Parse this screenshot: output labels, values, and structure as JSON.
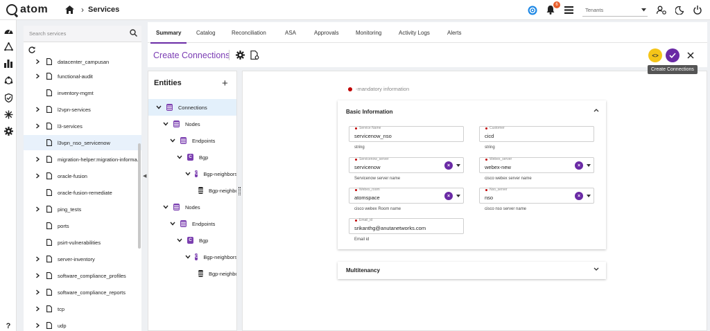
{
  "app": {
    "logo_text": "atom",
    "breadcrumb": "Services",
    "notification_count": "6",
    "tenant_placeholder": "Tenants"
  },
  "rail": {
    "help_label": "?"
  },
  "services": {
    "search_placeholder": "Search services",
    "items": [
      {
        "name": "datacenter_campusan",
        "expandable": true
      },
      {
        "name": "functional-audit",
        "expandable": true
      },
      {
        "name": "inventory-mgmt",
        "expandable": false
      },
      {
        "name": "l2vpn-services",
        "expandable": true
      },
      {
        "name": "l3-services",
        "expandable": true
      },
      {
        "name": "l3vpn_nso_servicenow",
        "expandable": false,
        "selected": true
      },
      {
        "name": "migration-helper:migration-informa...",
        "expandable": true
      },
      {
        "name": "oracle-fusion",
        "expandable": true
      },
      {
        "name": "oracle-fusion-remediate",
        "expandable": false
      },
      {
        "name": "ping_tests",
        "expandable": true
      },
      {
        "name": "ports",
        "expandable": false
      },
      {
        "name": "psirt-vulnerabilities",
        "expandable": false
      },
      {
        "name": "server-inventory",
        "expandable": true
      },
      {
        "name": "software_compliance_profiles",
        "expandable": true
      },
      {
        "name": "software_compliance_reports",
        "expandable": true
      },
      {
        "name": "tcp",
        "expandable": true
      },
      {
        "name": "udp",
        "expandable": true
      }
    ]
  },
  "tabs": [
    "Summary",
    "Catalog",
    "Reconciliation",
    "ASA",
    "Approvals",
    "Monitoring",
    "Activity Logs",
    "Alerts"
  ],
  "form": {
    "title": "Create Connections",
    "code_button_label": "<>",
    "tooltip": "Create Connections",
    "mandatory_text": "-mandatory information"
  },
  "entities": {
    "title": "Entities",
    "add_label": "+",
    "nodes": [
      {
        "label": "Connections",
        "level": 0,
        "icon": "list",
        "icon_text": "",
        "chevron": "down",
        "selected": true
      },
      {
        "label": "Nodes",
        "level": 1,
        "icon": "list",
        "icon_text": "",
        "chevron": "down"
      },
      {
        "label": "Endpoints",
        "level": 2,
        "icon": "list",
        "icon_text": "",
        "chevron": "down"
      },
      {
        "label": "Bgp",
        "level": 3,
        "icon": "cont",
        "icon_text": "C",
        "chevron": "down"
      },
      {
        "label": "Bgp-neighbors",
        "level": 4,
        "icon": "cont",
        "icon_text": "C",
        "chevron": "down"
      },
      {
        "label": "Bgp-neighbor",
        "level": 5,
        "icon": "leaf",
        "icon_text": "",
        "chevron": "none"
      },
      {
        "label": "Nodes",
        "level": 1,
        "icon": "list",
        "icon_text": "",
        "chevron": "down"
      },
      {
        "label": "Endpoints",
        "level": 2,
        "icon": "list",
        "icon_text": "",
        "chevron": "down"
      },
      {
        "label": "Bgp",
        "level": 3,
        "icon": "cont",
        "icon_text": "C",
        "chevron": "down"
      },
      {
        "label": "Bgp-neighbors",
        "level": 4,
        "icon": "cont",
        "icon_text": "C",
        "chevron": "down"
      },
      {
        "label": "Bgp-neighbor",
        "level": 5,
        "icon": "leaf",
        "icon_text": "",
        "chevron": "none"
      }
    ]
  },
  "basic_info": {
    "title": "Basic Information",
    "fields": [
      {
        "label": "Service Name",
        "value": "servicenow_nso",
        "help": "string",
        "dropdown": false
      },
      {
        "label": "Customer",
        "value": "cicd",
        "help": "string",
        "dropdown": false
      },
      {
        "label": "Servicenow_server",
        "value": "servicenow",
        "help": "Servicenow server name",
        "dropdown": true
      },
      {
        "label": "Webex_server",
        "value": "webex-new",
        "help": "cisco webex server name",
        "dropdown": true
      },
      {
        "label": "Webex_room",
        "value": "atomspace",
        "help": "cisco webex Room name",
        "dropdown": true
      },
      {
        "label": "Nso_server",
        "value": "nso",
        "help": "cisco nso server name",
        "dropdown": true
      },
      {
        "label": "Email_id",
        "value": "srikanthg@anutanetworks.com",
        "help": "Email id",
        "dropdown": false
      }
    ]
  },
  "multitenancy": {
    "title": "Multitenancy"
  },
  "colors": {
    "accent": "#6a2aa5",
    "code_button": "#f5c518",
    "required_dot": "#c00000",
    "badge": "#e95f2b"
  }
}
